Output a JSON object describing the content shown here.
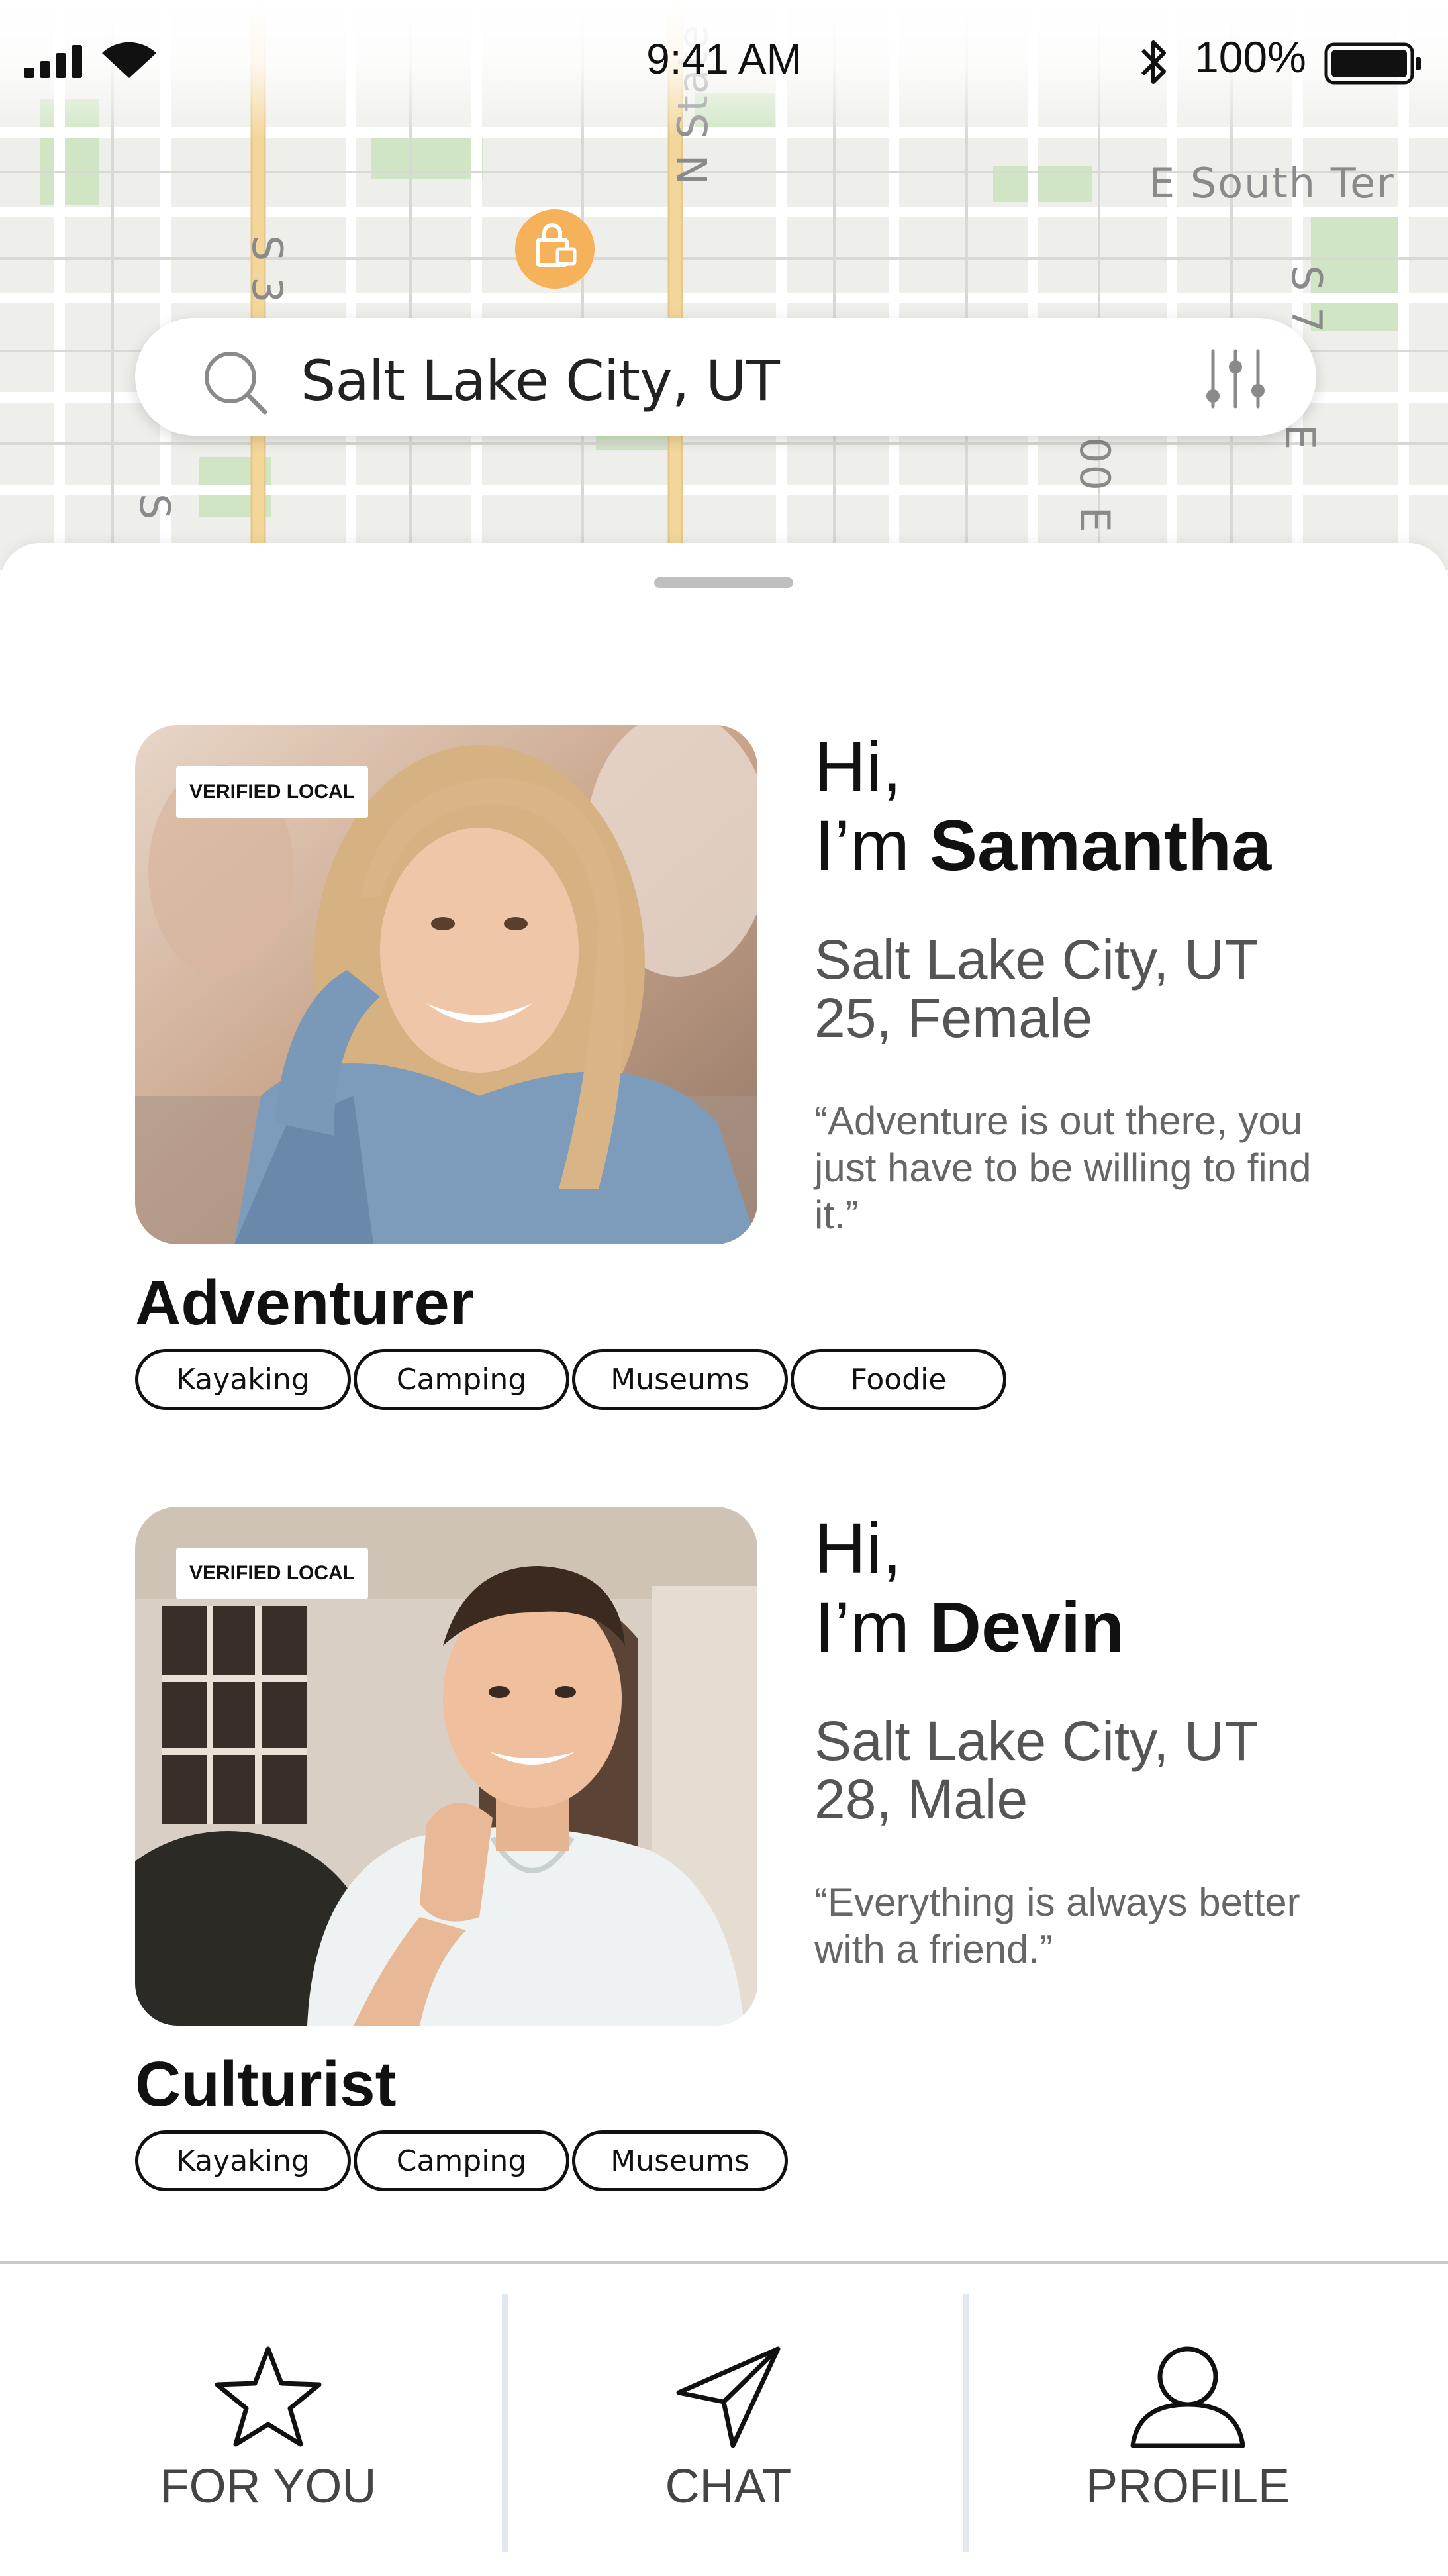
{
  "status_bar": {
    "time": "9:41 AM",
    "battery_percent": "100%",
    "icons": [
      "signal-icon",
      "wifi-icon",
      "bluetooth-icon",
      "battery-icon"
    ]
  },
  "map": {
    "labels": [
      "N State",
      "E South Ter",
      "S 3",
      "S",
      "00 E",
      "S 7",
      "E"
    ]
  },
  "search": {
    "value": "Salt Lake City, UT",
    "icons": [
      "search-icon",
      "filter-sliders-icon"
    ]
  },
  "profiles": [
    {
      "badge": "VERIFIED LOCAL",
      "greeting_line1": "Hi,",
      "greeting_prefix": "I’m",
      "name": "Samantha",
      "location": "Salt Lake City, UT",
      "age_gender": "25, Female",
      "quote": "“Adventure is out there, you just have to be willing to find it.”",
      "persona": "Adventurer",
      "tags": [
        "Kayaking",
        "Camping",
        "Museums",
        "Foodie"
      ]
    },
    {
      "badge": "VERIFIED LOCAL",
      "greeting_line1": "Hi,",
      "greeting_prefix": "I’m",
      "name": "Devin",
      "location": "Salt Lake City, UT",
      "age_gender": "28, Male",
      "quote": "“Everything is always better with a friend.”",
      "persona": "Culturist",
      "tags": [
        "Kayaking",
        "Camping",
        "Museums"
      ]
    }
  ],
  "nav": {
    "items": [
      {
        "label": "FOR YOU",
        "icon": "star-icon"
      },
      {
        "label": "CHAT",
        "icon": "send-icon"
      },
      {
        "label": "PROFILE",
        "icon": "user-icon"
      }
    ]
  },
  "colors": {
    "map_background": "#eeeeea",
    "map_park": "#cfe5c4",
    "map_road_major": "#f3d69a",
    "map_marker": "#f5b25a",
    "text_primary": "#111111",
    "text_secondary": "#555555",
    "nav_separator": "#e3e8ee"
  }
}
